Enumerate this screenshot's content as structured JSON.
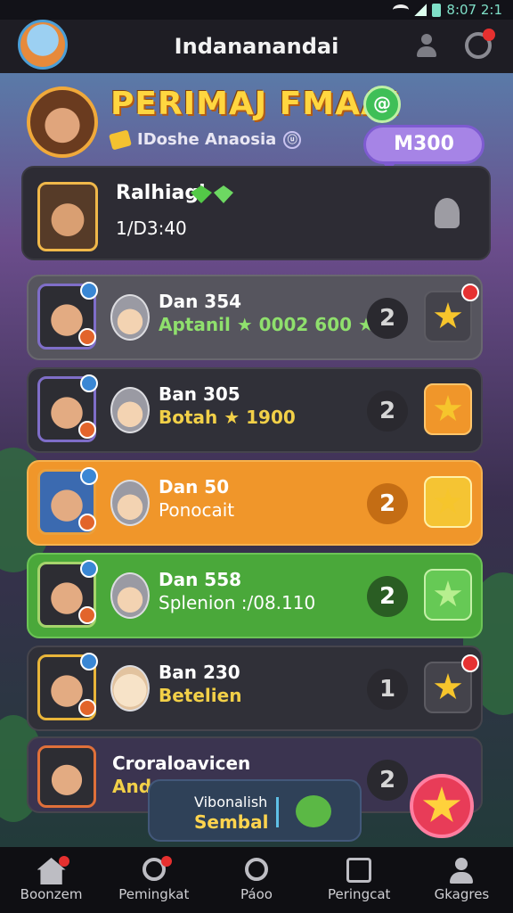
{
  "status": {
    "time": "8:07 2:1"
  },
  "appbar": {
    "title": "Indananandai"
  },
  "banner": {
    "title": "PERIMAJ FMAA!",
    "badge": "@",
    "subtitle": "IDoshe Anaosia",
    "info_icon": "ⓤ",
    "points": "M300"
  },
  "me": {
    "name": "Ralhiagl",
    "score": "1/D3:40"
  },
  "rows": [
    {
      "name": "Dan 354",
      "sub": "Aptanil  ★ 0002 600 ★",
      "rank": "2"
    },
    {
      "name": "Ban 305",
      "sub": "Botah  ★ 1900",
      "rank": "2"
    },
    {
      "name": "Dan 50",
      "sub": "Ponocait",
      "rank": "2"
    },
    {
      "name": "Dan 558",
      "sub": "Splenion :/08.110",
      "rank": "2"
    },
    {
      "name": "Ban 230",
      "sub": "Betelien",
      "rank": "1"
    },
    {
      "name": "Croraloavicen",
      "sub": "Andeo",
      "rank": "2"
    }
  ],
  "toast": {
    "line1": "Vibonalish",
    "line2": "Sembal"
  },
  "nav": [
    {
      "label": "Boonzem"
    },
    {
      "label": "Pemingkat"
    },
    {
      "label": "Páoo"
    },
    {
      "label": "Peringcat"
    },
    {
      "label": "Gkagres"
    }
  ],
  "colors": {
    "accent": "#f0962a",
    "highlight": "#4aa83a",
    "gold": "#ffd640",
    "pill": "#a684e6"
  }
}
